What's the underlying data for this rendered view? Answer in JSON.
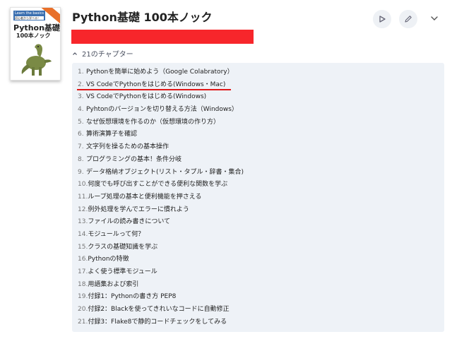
{
  "book": {
    "cover_tag": "Learn the basics",
    "cover_subtag": "初心者から学べる！",
    "cover_title": "Python基礎",
    "cover_subtitle": "100本ノック"
  },
  "header": {
    "title": "Python基礎 100本ノック",
    "play_icon": "play-icon",
    "edit_icon": "pencil-icon",
    "menu_icon": "chevron-down-icon"
  },
  "chapters": {
    "toggle_label": "21のチャプター",
    "items": [
      {
        "num": "1.",
        "label": "Pythonを簡単に始めよう（Google Colabratory）"
      },
      {
        "num": "2.",
        "label": "VS CodeでPythonをはじめる(Windows・Mac)"
      },
      {
        "num": "3.",
        "label": "VS CodeでPythonをはじめる(Windows)"
      },
      {
        "num": "4.",
        "label": "Pyhtonのバージョンを切り替える方法（Windows）"
      },
      {
        "num": "5.",
        "label": "なぜ仮想環境を作るのか（仮想環境の作り方）"
      },
      {
        "num": "6.",
        "label": "算術演算子を確認"
      },
      {
        "num": "7.",
        "label": "文字列を操るための基本操作"
      },
      {
        "num": "8.",
        "label": "プログラミングの基本！条件分岐"
      },
      {
        "num": "9.",
        "label": "データ格納オブジェクト(リスト・タプル・辞書・集合)"
      },
      {
        "num": "10.",
        "label": "何度でも呼び出すことができる便利な関数を学ぶ"
      },
      {
        "num": "11.",
        "label": "ループ処理の基本と便利機能を押さえる"
      },
      {
        "num": "12.",
        "label": "例外処理を学んでエラーに慣れよう"
      },
      {
        "num": "13.",
        "label": "ファイルの読み書きについて"
      },
      {
        "num": "14.",
        "label": "モジュールって何？"
      },
      {
        "num": "15.",
        "label": "クラスの基礎知識を学ぶ"
      },
      {
        "num": "16.",
        "label": "Pythonの特徴"
      },
      {
        "num": "17.",
        "label": "よく使う標準モジュール"
      },
      {
        "num": "18.",
        "label": "用語集および索引"
      },
      {
        "num": "19.",
        "label": "付録1：Pythonの書き方 PEP8"
      },
      {
        "num": "20.",
        "label": "付録2：Blackを使ってきれいなコードに自動修正"
      },
      {
        "num": "21.",
        "label": "付録3：Flake8で静的コードチェックをしてみる"
      }
    ]
  },
  "colors": {
    "redacted_bar": "#f7262b",
    "underline": "#e01818",
    "panel_bg": "#eef2f7"
  }
}
